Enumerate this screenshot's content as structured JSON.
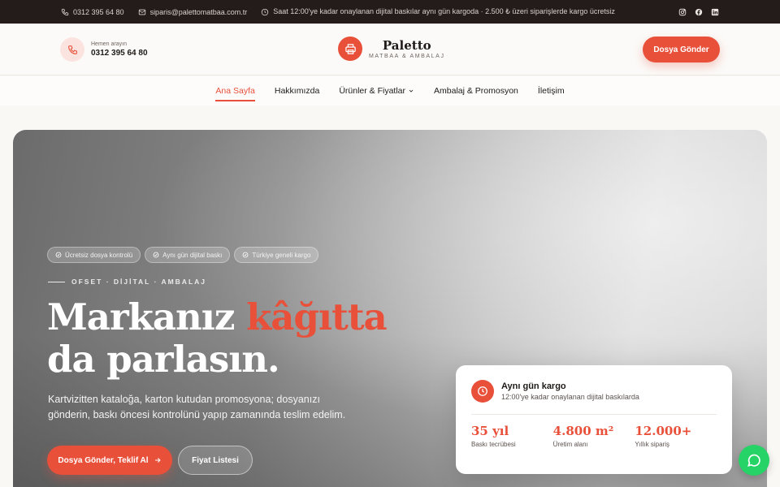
{
  "topbar": {
    "phone": "0312 395 64 80",
    "email": "siparis@palettomatbaa.com.tr",
    "notice": "Saat 12:00'ye kadar onaylanan dijital baskılar aynı gün kargoda · 2.500 ₺ üzeri siparişlerde kargo ücretsiz",
    "socials": [
      "instagram-icon",
      "facebook-icon",
      "linkedin-icon"
    ]
  },
  "header": {
    "call_label": "Hemen arayın",
    "call_number": "0312 395 64 80",
    "brand_name": "Paletto",
    "brand_tagline": "MATBAA & AMBALAJ",
    "send_button": "Dosya Gönder"
  },
  "nav": {
    "items": [
      "Ana Sayfa",
      "Hakkımızda",
      "Ürünler & Fiyatlar",
      "Ambalaj & Promosyon",
      "İletişim"
    ],
    "active": "Ana Sayfa"
  },
  "hero": {
    "pills": [
      "Ücretsiz dosya kontrolü",
      "Aynı gün dijital baskı",
      "Türkiye geneli kargo"
    ],
    "kicker": "OFSET · DİJİTAL · AMBALAJ",
    "headline_1": "Markanız ",
    "headline_accent": "kâğıtta",
    "headline_2": "da parlasın.",
    "description": "Kartvizitten kataloğa, karton kutudan promosyona; dosyanızı gönderin, baskı öncesi kontrolünü yapıp zamanında teslim edelim.",
    "cta_primary": "Dosya Gönder, Teklif Al",
    "cta_secondary": "Fiyat Listesi"
  },
  "card": {
    "title": "Aynı gün kargo",
    "subtitle": "12:00'ye kadar onaylanan dijital baskılarda",
    "stats": [
      {
        "value": "35 yıl",
        "label": "Baskı tecrübesi"
      },
      {
        "value": "4.800 m²",
        "label": "Üretim alanı"
      },
      {
        "value": "12.000+",
        "label": "Yıllık sipariş"
      }
    ]
  },
  "colors": {
    "accent": "#e8503a",
    "topbar": "#231c1a",
    "whatsapp": "#25d366"
  }
}
